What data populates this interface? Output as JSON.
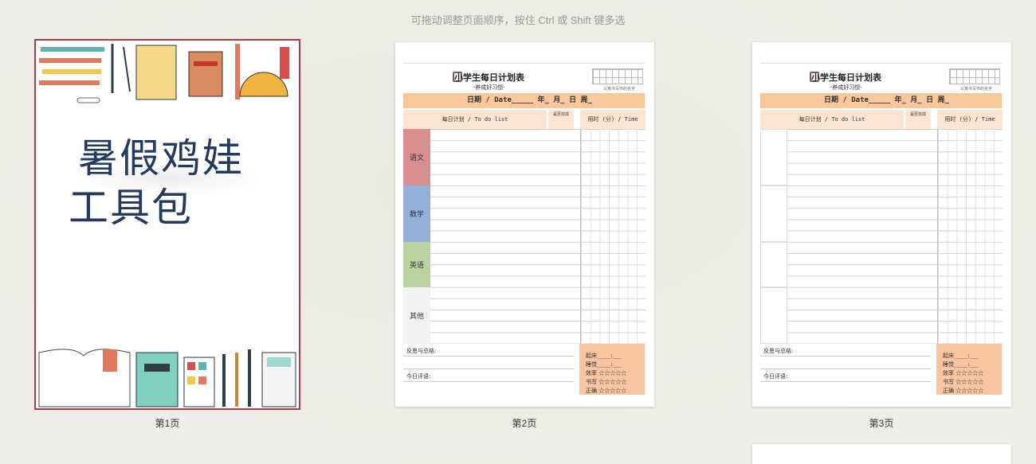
{
  "hint": "可拖动调整页面顺序，按住 Ctrl 或 Shift 键多选",
  "pages": [
    {
      "label": "第1页",
      "selected": true,
      "cover_title_line1": "暑假鸡娃",
      "cover_title_line2": "工具包"
    },
    {
      "label": "第2页",
      "selected": false
    },
    {
      "label": "第3页",
      "selected": false
    }
  ],
  "planner": {
    "title": "小学生每日计划表",
    "subtitle": "-养成好习惯-",
    "grid_note": "认真书写你的名字",
    "date_row": "日期 / Date_____ 年_ 月_ 日   周_",
    "todo_header": "每日计划 / To do list",
    "done_header": "是否完成",
    "time_header": "用时 (分) / Time",
    "subjects": [
      "语文",
      "数学",
      "英语",
      "其他"
    ],
    "subject_colors": [
      "#d98f8f",
      "#93b1d8",
      "#b8d3a0",
      "#f2f2f2"
    ],
    "footer_reflect": "反思与总结:",
    "footer_evaluate": "今日评语:",
    "footer_stats": [
      "起床_____:___",
      "睡觉_____:___",
      "效率 ☆☆☆☆☆",
      "书写 ☆☆☆☆☆",
      "正确 ☆☆☆☆☆"
    ]
  }
}
